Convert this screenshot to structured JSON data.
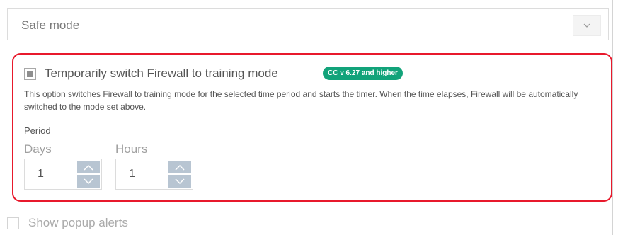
{
  "mode_select": {
    "value": "Safe mode",
    "dropdown_icon": "chevron-down-icon"
  },
  "training": {
    "checkbox_label": "Temporarily switch Firewall to training mode",
    "checked": true,
    "badge": "CC v 6.27 and higher",
    "description": "This option switches Firewall to training mode for the selected time period and starts the timer. When the time elapses, Firewall will be automatically switched to the mode set above.",
    "period_label": "Period",
    "days": {
      "label": "Days",
      "value": "1"
    },
    "hours": {
      "label": "Hours",
      "value": "1"
    }
  },
  "popup_alerts": {
    "label": "Show popup alerts",
    "checked": false
  },
  "colors": {
    "highlight_border": "#e8192c",
    "badge_bg": "#12a37a",
    "stepper_btn": "#b8c5d2"
  }
}
